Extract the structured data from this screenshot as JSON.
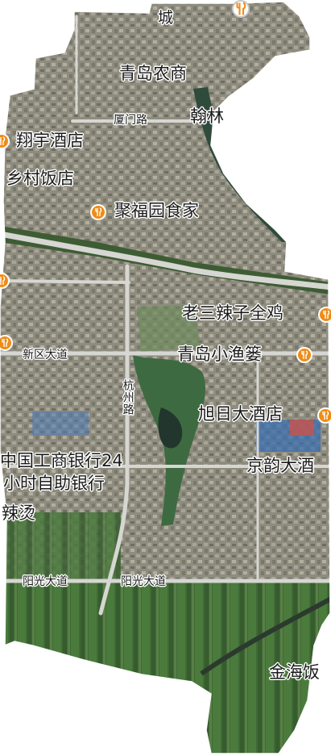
{
  "map": {
    "colors": {
      "background": "#ffffff",
      "urban": "#8b8a7d",
      "farmland": "#3f6a35",
      "river": "#2f4b3c",
      "road": "#d9d9d9",
      "poi_icon": "#f08c17"
    },
    "poi_labels": [
      {
        "name": "青岛农商",
        "icon": "dining-icon"
      },
      {
        "name": "翔宇酒店",
        "icon": "dining-icon"
      },
      {
        "name": "乡村饭店",
        "icon": "dining-icon"
      },
      {
        "name": "聚福园食家",
        "icon": "dining-icon"
      },
      {
        "name": "老三辣子全鸡",
        "icon": "dining-icon"
      },
      {
        "name": "青岛小渔篓",
        "icon": "dining-icon"
      },
      {
        "name": "旭日大酒店",
        "icon": "dining-icon"
      },
      {
        "name": "中国工商银行24",
        "icon": "bank-icon"
      },
      {
        "name": "小时自助银行",
        "icon": "bank-icon"
      },
      {
        "name": "辣烫",
        "icon": "dining-icon"
      },
      {
        "name": "京韵大酒",
        "icon": "dining-icon"
      },
      {
        "name": "金海饭",
        "icon": "dining-icon"
      },
      {
        "name": "翰林",
        "icon": "poi-icon"
      },
      {
        "name": "城",
        "icon": "poi-icon"
      }
    ],
    "road_labels": {
      "xiamen": "厦门路",
      "xinqu": "新区大道",
      "hangzhou": "杭州路",
      "yangguang_west": "阳光大道",
      "yangguang_east": "阳光大道"
    }
  }
}
